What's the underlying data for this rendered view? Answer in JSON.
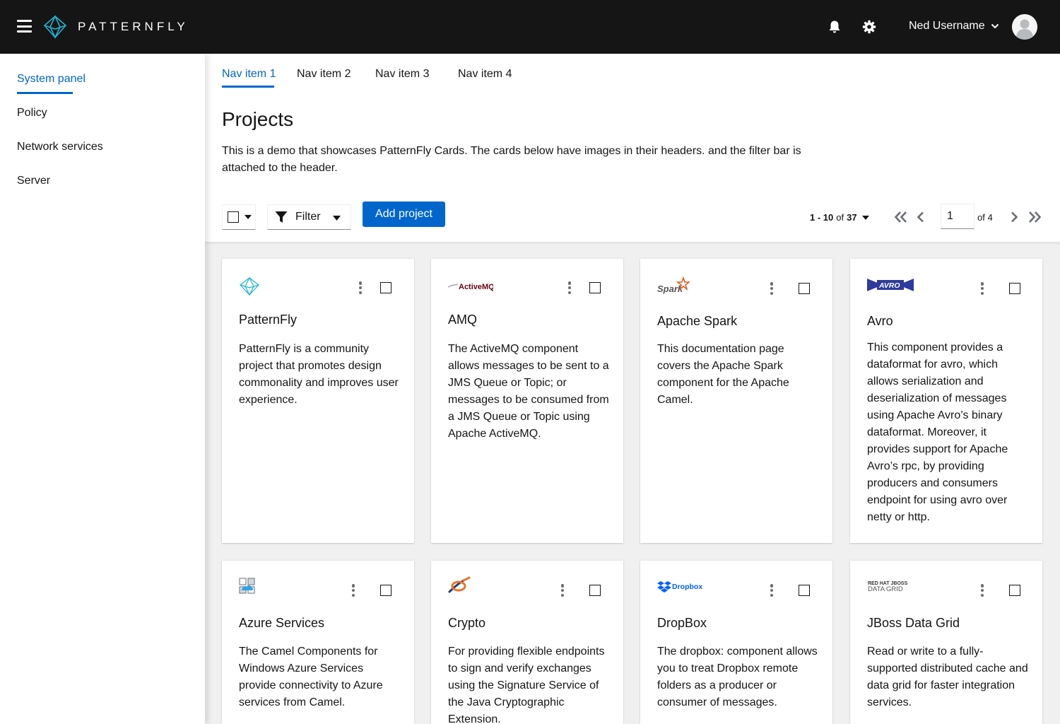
{
  "masthead": {
    "brand": "PATTERNFLY",
    "user_name": "Ned Username"
  },
  "sidebar": {
    "items": [
      {
        "label": "System panel",
        "active": true
      },
      {
        "label": "Policy"
      },
      {
        "label": "Network services"
      },
      {
        "label": "Server"
      }
    ]
  },
  "tabs": [
    {
      "label": "Nav item 1",
      "active": true
    },
    {
      "label": "Nav item 2"
    },
    {
      "label": "Nav item 3"
    },
    {
      "label": "Nav item 4"
    }
  ],
  "page": {
    "title": "Projects",
    "description": "This is a demo that showcases PatternFly Cards. The cards below have images in their headers. and the filter bar is attached to the header."
  },
  "toolbar": {
    "filter_label": "Filter",
    "add_label": "Add project",
    "pagination_range": "1 - 10",
    "pagination_of": "of",
    "pagination_total": "37",
    "current_page": "1",
    "of_pages": "of 4"
  },
  "cards": [
    {
      "title": "PatternFly",
      "logo": "patternfly-logo",
      "body": "PatternFly is a community project that promotes design commonality and improves user experience."
    },
    {
      "title": "AMQ",
      "logo": "activemq-logo",
      "logo_text": "ActiveMQ",
      "body": "The ActiveMQ component allows messages to be sent to a JMS Queue or Topic; or messages to be consumed from a JMS Queue or Topic using Apache ActiveMQ."
    },
    {
      "title": "Apache Spark",
      "logo": "spark-logo",
      "logo_text": "Spark",
      "body": "This documentation page covers the Apache Spark component for the Apache Camel."
    },
    {
      "title": "Avro",
      "logo": "avro-logo",
      "logo_text": "AVRO",
      "body": "This component provides a dataformat for avro, which allows serialization and deserialization of messages using Apache Avro’s binary dataformat. Moreover, it provides support for Apache Avro’s rpc, by providing producers and consumers endpoint for using avro over netty or http."
    },
    {
      "title": "Azure Services",
      "logo": "azure-logo",
      "body": "The Camel Components for Windows Azure Services provide connectivity to Azure services from Camel."
    },
    {
      "title": "Crypto",
      "logo": "crypto-logo",
      "body": "For providing flexible endpoints to sign and verify exchanges using the Signature Service of the Java Cryptographic Extension."
    },
    {
      "title": "DropBox",
      "logo": "dropbox-logo",
      "logo_text": "Dropbox",
      "body": "The dropbox: component allows you to treat Dropbox remote folders as a producer or consumer of messages."
    },
    {
      "title": "JBoss Data Grid",
      "logo": "jboss-logo",
      "logo_text": "RED HAT JBOSS",
      "logo_text2": "DATA GRID",
      "body": "Read or write to a fully-supported distributed cache and data grid for faster integration services."
    }
  ],
  "colors": {
    "masthead_bg": "#151515",
    "accent": "#06c",
    "gallery_bg": "#f0f0f0"
  }
}
